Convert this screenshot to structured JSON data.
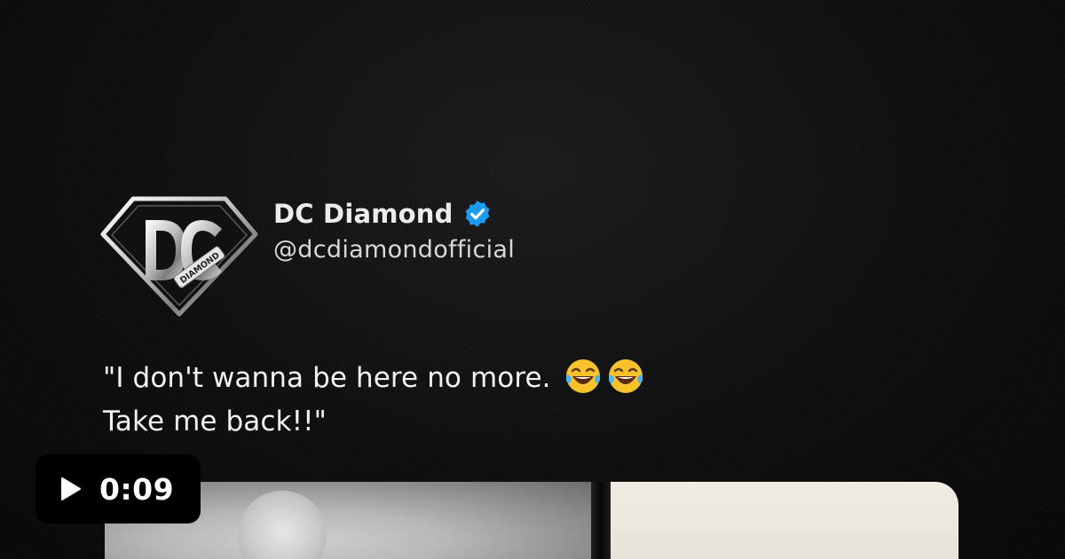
{
  "post": {
    "author_name": "DC Diamond",
    "author_handle": "@dcdiamondofficial",
    "avatar_text": "DIAMOND",
    "text_line1": "\"I don't wanna be here no more.",
    "text_line2": "Take me back!!\"",
    "emoji_icons": [
      "face-with-tears-of-joy-icon",
      "face-with-tears-of-joy-icon"
    ]
  },
  "video": {
    "duration": "0:09",
    "icon": "play-icon"
  },
  "colors": {
    "background": "#0b0b0b",
    "verified": "#1d9bf0",
    "text": "#f2f2f2"
  }
}
